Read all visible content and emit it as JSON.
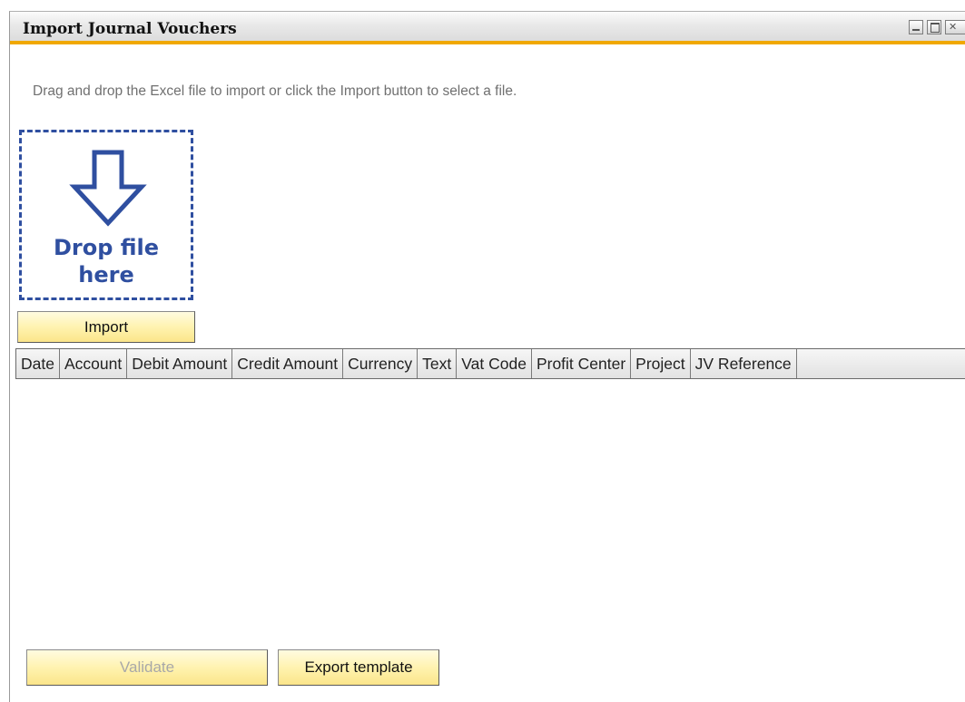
{
  "window": {
    "title": "Import Journal Vouchers"
  },
  "instruction": "Drag and drop the Excel file to import or click the Import button to select a file.",
  "dropzone": {
    "line1": "Drop file",
    "line2": "here",
    "icon": "down-arrow-icon",
    "color": "#2f4fa0"
  },
  "buttons": {
    "import": "Import",
    "validate": "Validate",
    "export_template": "Export template"
  },
  "grid": {
    "columns": [
      "Date",
      "Account",
      "Debit Amount",
      "Credit Amount",
      "Currency",
      "Text",
      "Vat Code",
      "Profit Center",
      "Project",
      "JV Reference"
    ]
  },
  "colors": {
    "accent_bar": "#f0a800",
    "button_fill": "#fff3b0"
  }
}
